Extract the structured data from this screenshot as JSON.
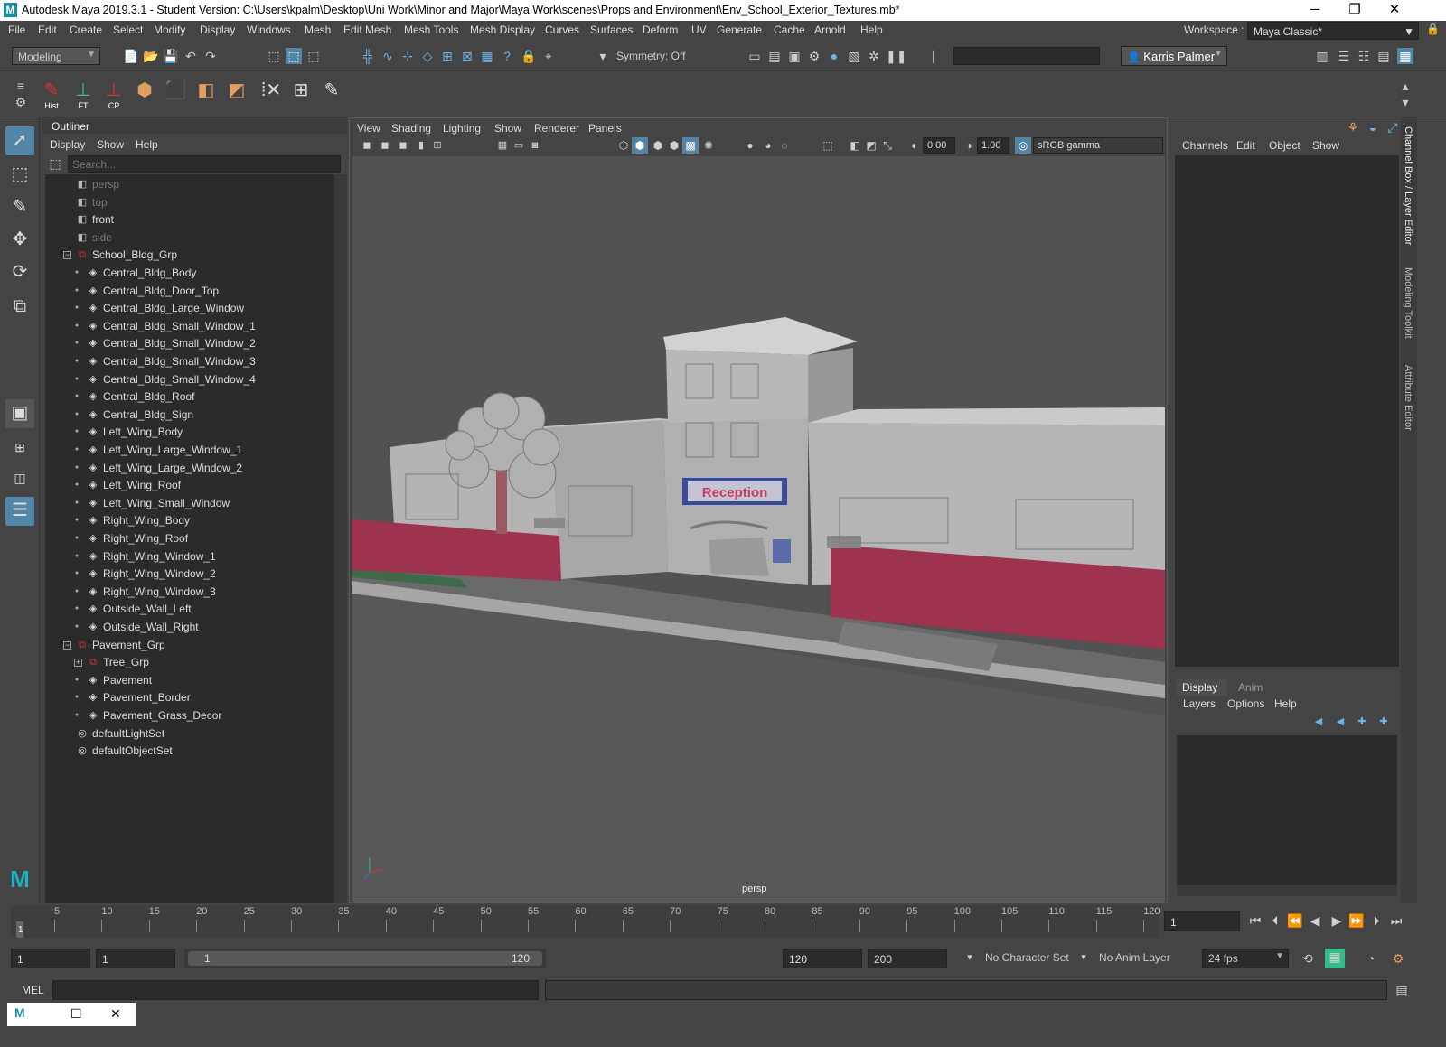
{
  "titlebar": {
    "title": "Autodesk Maya 2019.3.1 - Student Version: C:\\Users\\kpalm\\Desktop\\Uni Work\\Minor and Major\\Maya Work\\scenes\\Props and Environment\\Env_School_Exterior_Textures.mb*",
    "logo": "M",
    "minimize": "─",
    "restore": "❐",
    "close": "✕"
  },
  "menubar": {
    "items": [
      "File",
      "Edit",
      "Create",
      "Select",
      "Modify",
      "Display",
      "Windows",
      "Mesh",
      "Edit Mesh",
      "Mesh Tools",
      "Mesh Display",
      "Curves",
      "Surfaces",
      "Deform",
      "UV",
      "Generate",
      "Cache",
      "Arnold",
      "Help"
    ],
    "workspace_label": "Workspace :",
    "workspace_value": "Maya Classic*"
  },
  "statusline": {
    "menuset": "Modeling",
    "symmetry": "Symmetry: Off",
    "user": "Karris Palmer"
  },
  "shelf": {
    "buttons": [
      {
        "label": "Hist",
        "icon": "history-icon"
      },
      {
        "label": "FT",
        "icon": "freeze-transform-icon"
      },
      {
        "label": "CP",
        "icon": "center-pivot-icon"
      }
    ]
  },
  "outliner": {
    "title": "Outliner",
    "menu": [
      "Display",
      "Show",
      "Help"
    ],
    "search_placeholder": "Search...",
    "rows": [
      {
        "label": "persp",
        "type": "camera",
        "dim": true,
        "indent": 0
      },
      {
        "label": "top",
        "type": "camera",
        "dim": true,
        "indent": 0
      },
      {
        "label": "front",
        "type": "camera",
        "dim": false,
        "indent": 0
      },
      {
        "label": "side",
        "type": "camera",
        "dim": true,
        "indent": 0
      },
      {
        "label": "School_Bldg_Grp",
        "type": "group",
        "dim": false,
        "indent": -1,
        "expand": "−"
      },
      {
        "label": "Central_Bldg_Body",
        "type": "mesh",
        "dim": false,
        "indent": 1
      },
      {
        "label": "Central_Bldg_Door_Top",
        "type": "mesh",
        "dim": false,
        "indent": 1
      },
      {
        "label": "Central_Bldg_Large_Window",
        "type": "mesh",
        "dim": false,
        "indent": 1
      },
      {
        "label": "Central_Bldg_Small_Window_1",
        "type": "mesh",
        "dim": false,
        "indent": 1
      },
      {
        "label": "Central_Bldg_Small_Window_2",
        "type": "mesh",
        "dim": false,
        "indent": 1
      },
      {
        "label": "Central_Bldg_Small_Window_3",
        "type": "mesh",
        "dim": false,
        "indent": 1
      },
      {
        "label": "Central_Bldg_Small_Window_4",
        "type": "mesh",
        "dim": false,
        "indent": 1
      },
      {
        "label": "Central_Bldg_Roof",
        "type": "mesh",
        "dim": false,
        "indent": 1
      },
      {
        "label": "Central_Bldg_Sign",
        "type": "mesh",
        "dim": false,
        "indent": 1
      },
      {
        "label": "Left_Wing_Body",
        "type": "mesh",
        "dim": false,
        "indent": 1
      },
      {
        "label": "Left_Wing_Large_Window_1",
        "type": "mesh",
        "dim": false,
        "indent": 1
      },
      {
        "label": "Left_Wing_Large_Window_2",
        "type": "mesh",
        "dim": false,
        "indent": 1
      },
      {
        "label": "Left_Wing_Roof",
        "type": "mesh",
        "dim": false,
        "indent": 1
      },
      {
        "label": "Left_Wing_Small_Window",
        "type": "mesh",
        "dim": false,
        "indent": 1
      },
      {
        "label": "Right_Wing_Body",
        "type": "mesh",
        "dim": false,
        "indent": 1
      },
      {
        "label": "Right_Wing_Roof",
        "type": "mesh",
        "dim": false,
        "indent": 1
      },
      {
        "label": "Right_Wing_Window_1",
        "type": "mesh",
        "dim": false,
        "indent": 1
      },
      {
        "label": "Right_Wing_Window_2",
        "type": "mesh",
        "dim": false,
        "indent": 1
      },
      {
        "label": "Right_Wing_Window_3",
        "type": "mesh",
        "dim": false,
        "indent": 1
      },
      {
        "label": "Outside_Wall_Left",
        "type": "mesh",
        "dim": false,
        "indent": 1
      },
      {
        "label": "Outside_Wall_Right",
        "type": "mesh",
        "dim": false,
        "indent": 1
      },
      {
        "label": "Pavement_Grp",
        "type": "group",
        "dim": false,
        "indent": -1,
        "expand": "−"
      },
      {
        "label": "Tree_Grp",
        "type": "group",
        "dim": false,
        "indent": 1,
        "expand": "+"
      },
      {
        "label": "Pavement",
        "type": "mesh",
        "dim": false,
        "indent": 1
      },
      {
        "label": "Pavement_Border",
        "type": "mesh",
        "dim": false,
        "indent": 1
      },
      {
        "label": "Pavement_Grass_Decor",
        "type": "mesh",
        "dim": false,
        "indent": 1
      },
      {
        "label": "defaultLightSet",
        "type": "set",
        "dim": false,
        "indent": -1
      },
      {
        "label": "defaultObjectSet",
        "type": "set",
        "dim": false,
        "indent": -1
      }
    ]
  },
  "viewport": {
    "menu": [
      "View",
      "Shading",
      "Lighting",
      "Show",
      "Renderer",
      "Panels"
    ],
    "exposure": "0.00",
    "gamma": "1.00",
    "color_space": "sRGB gamma",
    "camera_label": "persp",
    "sign_text": "Reception"
  },
  "channelbox": {
    "menu": [
      "Channels",
      "Edit",
      "Object",
      "Show"
    ],
    "layer_tabs": [
      "Display",
      "Anim"
    ],
    "layer_menu": [
      "Layers",
      "Options",
      "Help"
    ]
  },
  "sidetabs": [
    "Channel Box / Layer Editor",
    "Modeling Toolkit",
    "Attribute Editor"
  ],
  "timeslider": {
    "ticks": [
      "5",
      "10",
      "15",
      "20",
      "25",
      "30",
      "35",
      "40",
      "45",
      "50",
      "55",
      "60",
      "65",
      "70",
      "75",
      "80",
      "85",
      "90",
      "95",
      "100",
      "105",
      "110",
      "115",
      "120"
    ],
    "current": "1",
    "current_field": "1"
  },
  "range": {
    "start": "1",
    "playback_start": "1",
    "slider_start": "1",
    "slider_end": "120",
    "playback_end": "120",
    "end": "200",
    "character_set": "No Character Set",
    "anim_layer": "No Anim Layer",
    "fps": "24 fps"
  },
  "cmdline": {
    "label": "MEL"
  },
  "colors": {
    "panel": "#444444",
    "field": "#2b2b2b",
    "selected": "#5285a6",
    "wall": "#9e3350",
    "building": "#b4b4b4"
  }
}
